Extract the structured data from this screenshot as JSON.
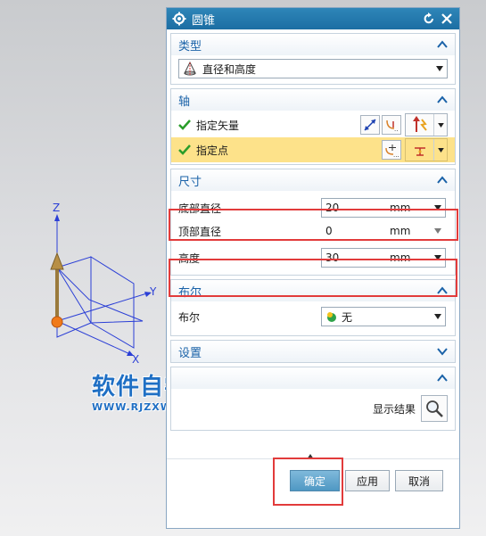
{
  "dialog": {
    "title": "圆锥"
  },
  "sections": {
    "type": {
      "header": "类型",
      "selected": "直径和高度"
    },
    "axis": {
      "header": "轴",
      "vector_label": "指定矢量",
      "point_label": "指定点"
    },
    "dimensions": {
      "header": "尺寸",
      "base_diameter": {
        "label": "底部直径",
        "value": "20",
        "unit": "mm"
      },
      "top_diameter": {
        "label": "顶部直径",
        "value": "0",
        "unit": "mm"
      },
      "height": {
        "label": "高度",
        "value": "30",
        "unit": "mm"
      }
    },
    "boolean": {
      "header": "布尔",
      "label": "布尔",
      "selected": "无"
    },
    "settings": {
      "header": "设置"
    },
    "preview": {
      "show_result_label": "显示结果"
    }
  },
  "footer": {
    "ok": "确定",
    "apply": "应用",
    "cancel": "取消"
  },
  "axes_triad": {
    "x": "X",
    "y": "Y",
    "z": "Z"
  },
  "watermark": {
    "title": "软件自学网",
    "url": "WWW.RJZXW.COM"
  },
  "colors": {
    "accent_header": "#1a62a8",
    "highlight_row": "#fde28a",
    "primary_button": "#4f98c3",
    "annotation_frame": "#e23b3b"
  }
}
